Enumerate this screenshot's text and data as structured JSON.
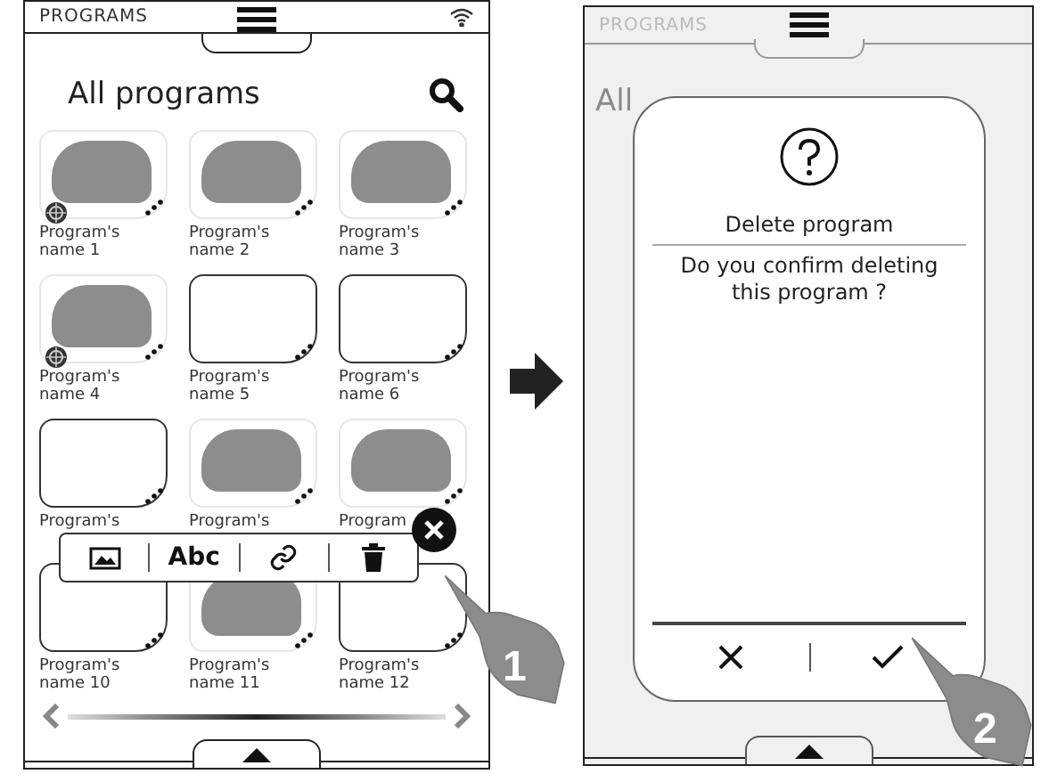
{
  "list_screen": {
    "header_title": "PROGRAMS",
    "title": "All programs",
    "programs": [
      {
        "name": "Program's name 1",
        "kind": "photo",
        "badge": true
      },
      {
        "name": "Program's name 2",
        "kind": "photo",
        "badge": false
      },
      {
        "name": "Program's name 3",
        "kind": "photo",
        "badge": false
      },
      {
        "name": "Program's name 4",
        "kind": "photo",
        "badge": true
      },
      {
        "name": "Program's name 5",
        "kind": "empty",
        "badge": false
      },
      {
        "name": "Program's name 6",
        "kind": "empty",
        "badge": false
      },
      {
        "name": "Program's",
        "kind": "empty",
        "badge": false
      },
      {
        "name": "Program's",
        "kind": "photo",
        "badge": false
      },
      {
        "name": "Program",
        "kind": "photo",
        "badge": false
      },
      {
        "name": "Program's name 10",
        "kind": "empty",
        "badge": false
      },
      {
        "name": "Program's name 11",
        "kind": "photo",
        "badge": false
      },
      {
        "name": "Program's name 12",
        "kind": "empty",
        "badge": false
      }
    ],
    "toolbar": [
      {
        "kind": "image"
      },
      {
        "kind": "text",
        "label": "Abc"
      },
      {
        "kind": "link"
      },
      {
        "kind": "delete"
      }
    ],
    "step": "1"
  },
  "dialog_screen": {
    "header_title": "PROGRAMS",
    "background_title": "All",
    "dialog": {
      "title": "Delete program",
      "message": "Do you confirm deleting this program ?"
    },
    "step": "2"
  }
}
